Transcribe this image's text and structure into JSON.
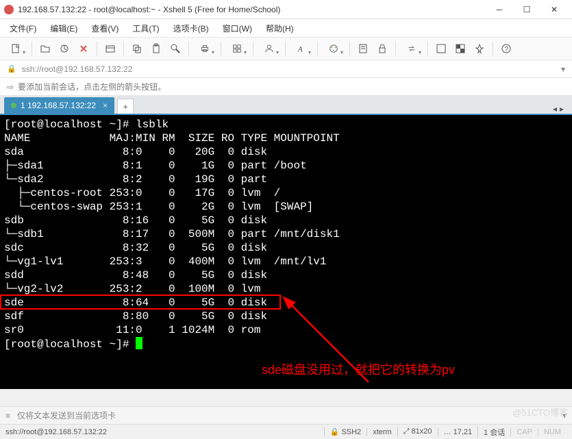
{
  "window": {
    "title": "192.168.57.132:22 - root@localhost:~ - Xshell 5 (Free for Home/School)"
  },
  "menu": {
    "file": "文件(F)",
    "edit": "编辑(E)",
    "view": "查看(V)",
    "tools": "工具(T)",
    "tabs": "选项卡(B)",
    "window": "窗口(W)",
    "help": "帮助(H)"
  },
  "address": {
    "text": "ssh://root@192.168.57.132:22"
  },
  "tip": {
    "text": "要添加当前会话，点击左侧的箭头按钮。"
  },
  "tabsrow": {
    "tab1_label": "1 192.168.57.132:22",
    "add": "+"
  },
  "terminal": {
    "prompt1": "[root@localhost ~]# ",
    "cmd": "lsblk",
    "header": "NAME            MAJ:MIN RM  SIZE RO TYPE MOUNTPOINT",
    "rows": [
      "sda               8:0    0   20G  0 disk ",
      "├─sda1            8:1    0    1G  0 part /boot",
      "└─sda2            8:2    0   19G  0 part ",
      "  ├─centos-root 253:0    0   17G  0 lvm  /",
      "  └─centos-swap 253:1    0    2G  0 lvm  [SWAP]",
      "sdb               8:16   0    5G  0 disk ",
      "└─sdb1            8:17   0  500M  0 part /mnt/disk1",
      "sdc               8:32   0    5G  0 disk ",
      "└─vg1-lv1       253:3    0  400M  0 lvm  /mnt/lv1",
      "sdd               8:48   0    5G  0 disk ",
      "└─vg2-lv2       253:2    0  100M  0 lvm  ",
      "sde               8:64   0    5G  0 disk ",
      "sdf               8:80   0    5G  0 disk ",
      "sr0              11:0    1 1024M  0 rom  "
    ],
    "prompt2": "[root@localhost ~]# ",
    "annotation": "sde磁盘没用过，就把它的转换为pv"
  },
  "bottom": {
    "input_tip": "仅将文本发送到当前选项卡"
  },
  "status": {
    "path": "ssh://root@192.168.57.132:22",
    "s1": "SSH2",
    "s2": "xterm",
    "s3": "81x20",
    "s4": "17,21",
    "s5": "1 会话",
    "cap": "CAP",
    "num": "NUM"
  },
  "watermark": "@51CTO博客"
}
